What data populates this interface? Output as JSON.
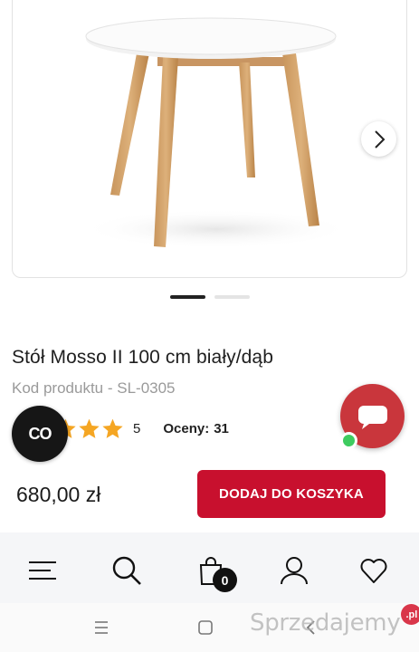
{
  "product": {
    "title": "Stół Mosso II 100 cm biały/dąb",
    "sku_label": "Kod produktu - SL-0305",
    "rating_value": "5",
    "rating_stars": 5,
    "reviews_label": "Oceny:",
    "reviews_count": "31",
    "price": "680,00 zł"
  },
  "gallery": {
    "slide_count": 2,
    "active_slide": 1,
    "next_icon": "chevron-right-icon"
  },
  "actions": {
    "add_to_cart_label": "DODAJ DO KOSZYKA"
  },
  "badges": {
    "co_label": "CO"
  },
  "bottom_nav": {
    "items": [
      {
        "icon": "menu-icon"
      },
      {
        "icon": "search-icon"
      },
      {
        "icon": "cart-icon"
      },
      {
        "icon": "user-icon"
      },
      {
        "icon": "heart-icon"
      }
    ],
    "cart_count": "0"
  },
  "watermark": {
    "text": "Sprzedajemy",
    "badge": ".pl"
  },
  "colors": {
    "accent_red": "#c8102e",
    "chat_red": "#c9363c",
    "star_gold": "#f5a623",
    "online_green": "#3ecb5f"
  }
}
